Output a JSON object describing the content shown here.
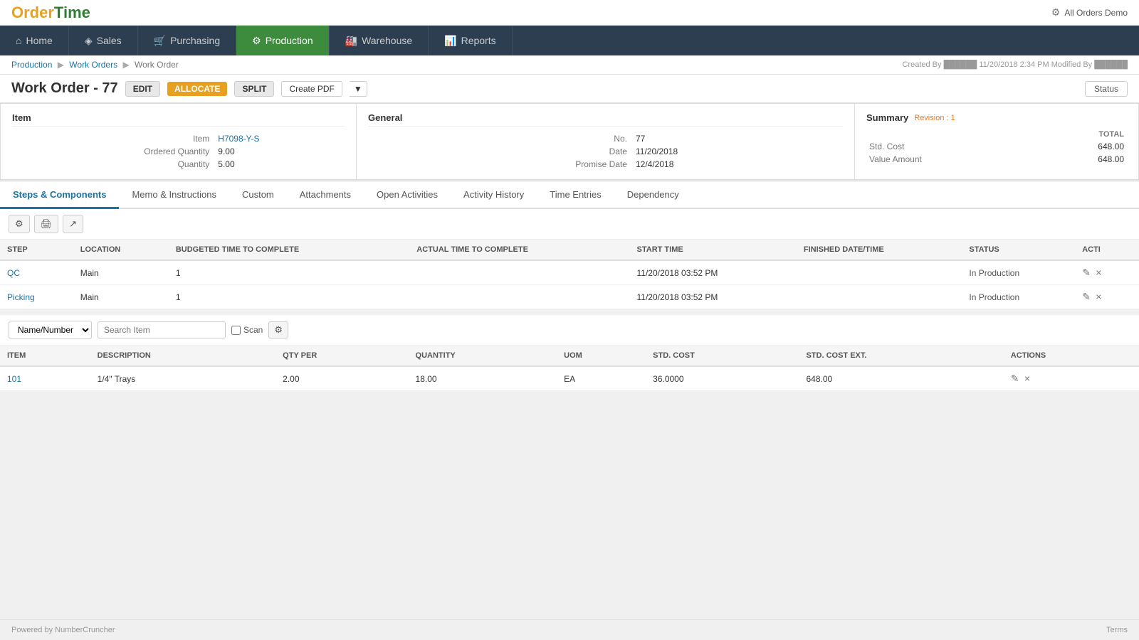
{
  "app": {
    "logo_order": "Order",
    "logo_time": "Time",
    "top_right": "All Orders Demo",
    "gear_label": "⚙"
  },
  "nav": {
    "items": [
      {
        "id": "home",
        "label": "Home",
        "icon": "⌂",
        "active": false
      },
      {
        "id": "sales",
        "label": "Sales",
        "icon": "◈",
        "active": false
      },
      {
        "id": "purchasing",
        "label": "Purchasing",
        "icon": "🛒",
        "active": false
      },
      {
        "id": "production",
        "label": "Production",
        "icon": "⚙",
        "active": true
      },
      {
        "id": "warehouse",
        "label": "Warehouse",
        "icon": "🏭",
        "active": false
      },
      {
        "id": "reports",
        "label": "Reports",
        "icon": "📊",
        "active": false
      }
    ]
  },
  "breadcrumb": {
    "items": [
      "Production",
      "Work Orders",
      "Work Order"
    ],
    "meta": "Created By ██████ 11/20/2018 2:34 PM   Modified By ██████"
  },
  "page": {
    "title": "Work Order - 77",
    "buttons": {
      "edit": "EDIT",
      "allocate": "ALLOCATE",
      "split": "SPLIT",
      "create_pdf": "Create PDF",
      "status": "Status"
    }
  },
  "item_panel": {
    "title": "Item",
    "fields": [
      {
        "label": "Item",
        "value": "H7098-Y-S",
        "link": true
      },
      {
        "label": "Ordered Quantity",
        "value": "9.00",
        "link": false
      },
      {
        "label": "Quantity",
        "value": "5.00",
        "link": false
      }
    ]
  },
  "general_panel": {
    "title": "General",
    "fields": [
      {
        "label": "No.",
        "value": "77",
        "link": false
      },
      {
        "label": "Date",
        "value": "11/20/2018",
        "link": false
      },
      {
        "label": "Promise Date",
        "value": "12/4/2018",
        "link": false
      }
    ]
  },
  "summary_panel": {
    "title": "Summary",
    "revision": "Revision : 1",
    "total_label": "TOTAL",
    "rows": [
      {
        "label": "Std. Cost",
        "value": "648.00"
      },
      {
        "label": "Value Amount",
        "value": "648.00"
      }
    ]
  },
  "tabs": [
    {
      "id": "steps",
      "label": "Steps & Components",
      "active": true
    },
    {
      "id": "memo",
      "label": "Memo & Instructions",
      "active": false
    },
    {
      "id": "custom",
      "label": "Custom",
      "active": false
    },
    {
      "id": "attachments",
      "label": "Attachments",
      "active": false
    },
    {
      "id": "open_activities",
      "label": "Open Activities",
      "active": false
    },
    {
      "id": "activity_history",
      "label": "Activity History",
      "active": false
    },
    {
      "id": "time_entries",
      "label": "Time Entries",
      "active": false
    },
    {
      "id": "dependency",
      "label": "Dependency",
      "active": false
    }
  ],
  "steps_table": {
    "columns": [
      "STEP",
      "LOCATION",
      "BUDGETED TIME TO COMPLETE",
      "ACTUAL TIME TO COMPLETE",
      "START TIME",
      "FINISHED DATE/TIME",
      "STATUS",
      "ACTI"
    ],
    "rows": [
      {
        "step": "QC",
        "location": "Main",
        "budgeted": "1",
        "actual": "",
        "start_time": "11/20/2018 03:52 PM",
        "finished": "",
        "status": "In Production"
      },
      {
        "step": "Picking",
        "location": "Main",
        "budgeted": "1",
        "actual": "",
        "start_time": "11/20/2018 03:52 PM",
        "finished": "",
        "status": "In Production"
      }
    ]
  },
  "component_search": {
    "filter_options": [
      "Name/Number"
    ],
    "filter_selected": "Name/Number",
    "search_placeholder": "Search Item",
    "scan_label": "Scan"
  },
  "components_table": {
    "columns": [
      "ITEM",
      "DESCRIPTION",
      "QTY PER",
      "QUANTITY",
      "UOM",
      "STD. COST",
      "STD. COST EXT.",
      "ACTIONS"
    ],
    "rows": [
      {
        "item": "101",
        "description": "1/4\" Trays",
        "qty_per": "2.00",
        "quantity": "18.00",
        "uom": "EA",
        "std_cost": "36.0000",
        "std_cost_ext": "648.00"
      }
    ]
  },
  "footer": {
    "left": "Powered by NumberCruncher",
    "right": "Terms"
  }
}
